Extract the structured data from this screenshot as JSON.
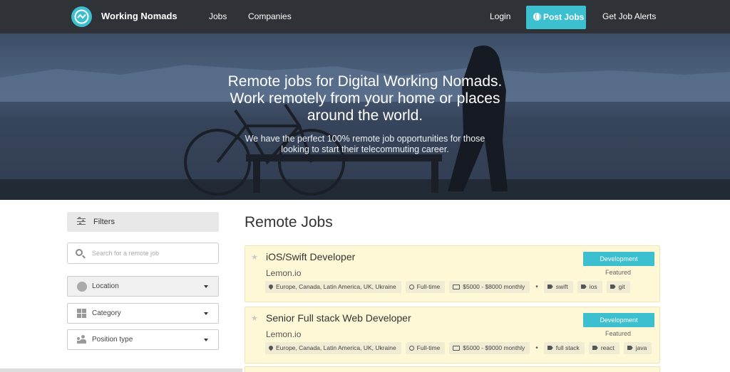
{
  "nav": {
    "brand": "Working Nomads",
    "links": [
      "Jobs",
      "Companies"
    ],
    "login": "Login",
    "post_jobs": "Post Jobs",
    "alerts": "Get Job Alerts"
  },
  "hero": {
    "title_lines": [
      "Remote jobs for Digital Working Nomads.",
      "Work remotely from your home or places",
      "around the world."
    ],
    "subtitle_lines": [
      "We have the perfect 100% remote job opportunities for those",
      "looking to start their telecommuting career."
    ]
  },
  "sidebar": {
    "filters_label": "Filters",
    "search_placeholder": "Search for a remote job",
    "location_label": "Location",
    "category_label": "Category",
    "position_label": "Position type"
  },
  "main": {
    "title": "Remote Jobs",
    "jobs": [
      {
        "title": "iOS/Swift Developer",
        "company": "Lemon.io",
        "category": "Development",
        "featured": "Featured",
        "location": "Europe, Canada, Latin America, UK, Ukraine",
        "type": "Full-time",
        "salary": "$5000 - $8000 monthly",
        "tags": [
          "swift",
          "ios",
          "git"
        ]
      },
      {
        "title": "Senior Full stack Web Developer",
        "company": "Lemon.io",
        "category": "Development",
        "featured": "Featured",
        "location": "Europe, Canada, Latin America, UK, Ukraine",
        "type": "Full-time",
        "salary": "$5000 - $9000 monthly",
        "tags": [
          "full stack",
          "react",
          "java"
        ]
      }
    ]
  },
  "colors": {
    "nav_bg": "#2f3338",
    "accent": "#3cbfcf",
    "card_bg": "#fff8d6"
  }
}
